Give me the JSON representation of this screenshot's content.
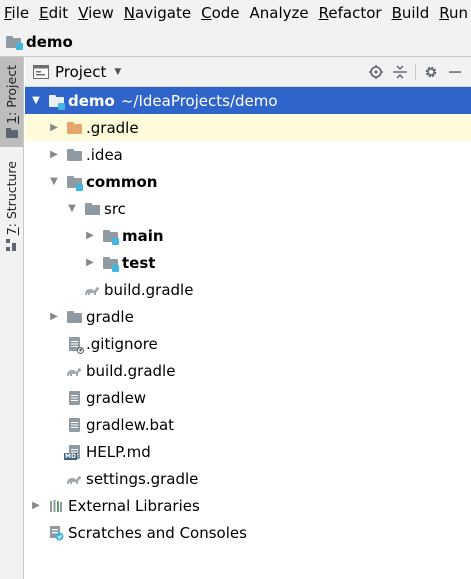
{
  "menu": [
    {
      "mnemonic": "F",
      "rest": "ile"
    },
    {
      "mnemonic": "E",
      "rest": "dit"
    },
    {
      "mnemonic": "V",
      "rest": "iew"
    },
    {
      "mnemonic": "N",
      "rest": "avigate"
    },
    {
      "mnemonic": "C",
      "rest": "ode"
    },
    {
      "mnemonic": "",
      "rest": "Analyze"
    },
    {
      "mnemonic": "R",
      "rest": "efactor"
    },
    {
      "mnemonic": "B",
      "rest": "uild"
    },
    {
      "mnemonic": "R",
      "rest": "un"
    }
  ],
  "navbar": {
    "crumb": "demo"
  },
  "stripe": {
    "project": {
      "number": "1",
      "label": ": Project"
    },
    "structure": {
      "number": "7",
      "label": ": Structure"
    }
  },
  "toolwindow": {
    "title": "Project"
  },
  "tree": [
    {
      "label": "demo",
      "suffix": "~/IdeaProjects/demo",
      "icon": "module-folder-icon"
    },
    {
      "label": ".gradle",
      "icon": "folder-icon"
    },
    {
      "label": ".idea",
      "icon": "folder-icon"
    },
    {
      "label": "common",
      "icon": "module-folder-icon"
    },
    {
      "label": "src",
      "icon": "folder-icon"
    },
    {
      "label": "main",
      "icon": "module-folder-icon"
    },
    {
      "label": "test",
      "icon": "module-folder-icon"
    },
    {
      "label": "build.gradle",
      "icon": "gradle-icon"
    },
    {
      "label": "gradle",
      "icon": "folder-icon"
    },
    {
      "label": ".gitignore",
      "icon": "gitignore-icon"
    },
    {
      "label": "build.gradle",
      "icon": "gradle-icon"
    },
    {
      "label": "gradlew",
      "icon": "text-file-icon"
    },
    {
      "label": "gradlew.bat",
      "icon": "text-file-icon"
    },
    {
      "label": "HELP.md",
      "icon": "markdown-icon"
    },
    {
      "label": "settings.gradle",
      "icon": "gradle-icon"
    },
    {
      "label": "External Libraries",
      "icon": "library-icon"
    },
    {
      "label": "Scratches and Consoles",
      "icon": "scratches-icon"
    }
  ]
}
